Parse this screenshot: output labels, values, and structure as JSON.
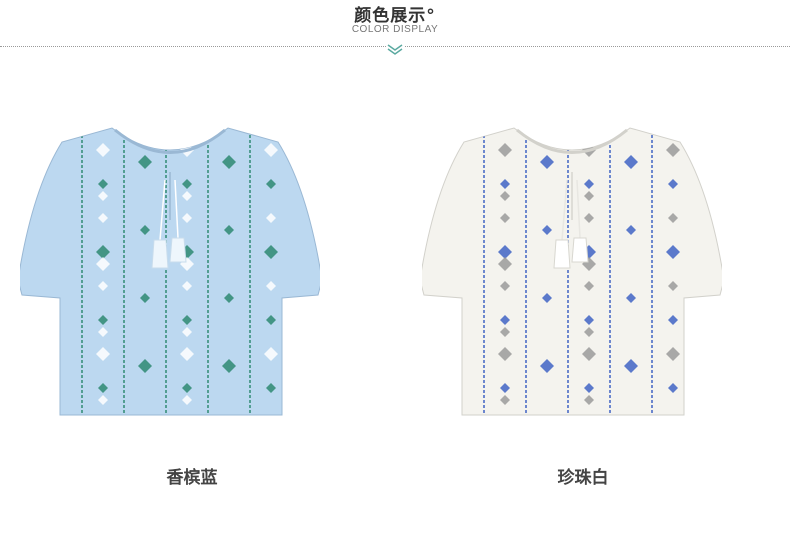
{
  "header": {
    "title": "颜色展示°",
    "subtitle": "COLOR DISPLAY"
  },
  "products": [
    {
      "label": "香槟蓝",
      "fabric_color": "#bcd8f0",
      "pattern_primary": "#2e8a72",
      "pattern_secondary": "#ffffff"
    },
    {
      "label": "珍珠白",
      "fabric_color": "#f4f3ee",
      "pattern_primary": "#3f63c4",
      "pattern_secondary": "#9a9a9a"
    }
  ],
  "colors": {
    "accent": "#5aa9a0"
  }
}
